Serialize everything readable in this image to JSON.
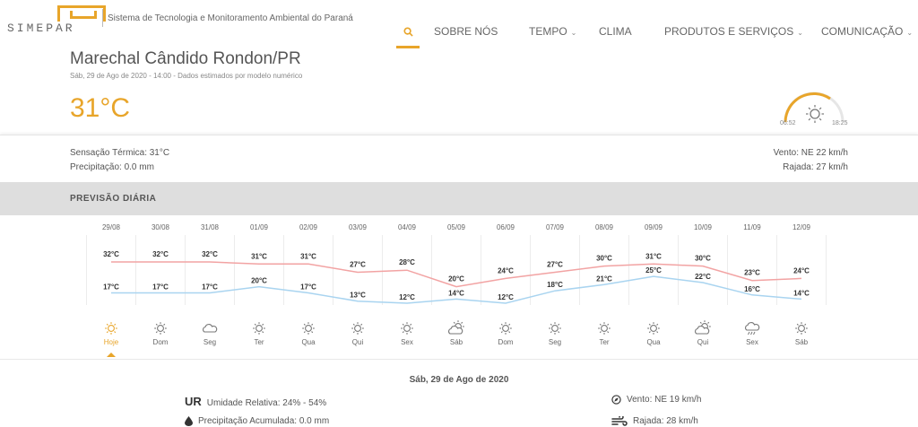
{
  "header": {
    "logo_text": "SIMEPAR",
    "org_name": "Sistema de Tecnologia e Monitoramento Ambiental do Paraná",
    "nav": [
      {
        "label": "SOBRE NÓS",
        "has_caret": false
      },
      {
        "label": "TEMPO",
        "has_caret": true
      },
      {
        "label": "CLIMA",
        "has_caret": false
      },
      {
        "label": "PRODUTOS E SERVIÇOS",
        "has_caret": true
      },
      {
        "label": "COMUNICAÇÃO",
        "has_caret": true
      }
    ],
    "search_icon": "search-icon"
  },
  "current": {
    "city": "Marechal Cândido Rondon/PR",
    "datetime": "Sáb, 29 de Ago de 2020 - 14:00 - Dados estimados por modelo numérico",
    "temperature": "31°C",
    "sunrise": "06:52",
    "sunset": "18:25"
  },
  "details": {
    "sensacao": "Sensação Térmica: 31°C",
    "precipitacao": "Precipitação: 0.0 mm",
    "vento": "Vento: NE 22 km/h",
    "rajada": "Rajada: 27 km/h"
  },
  "section": {
    "title": "PREVISÃO DIÁRIA"
  },
  "chart_data": {
    "type": "line",
    "x": [
      "29/08",
      "30/08",
      "31/08",
      "01/09",
      "02/09",
      "03/09",
      "04/09",
      "05/09",
      "06/09",
      "07/09",
      "08/09",
      "09/09",
      "10/09",
      "11/09",
      "12/09"
    ],
    "series": [
      {
        "values": [
          32,
          32,
          32,
          31,
          31,
          27,
          28,
          20,
          24,
          27,
          30,
          31,
          30,
          23,
          24
        ],
        "color": "#f2a3a3"
      },
      {
        "values": [
          17,
          17,
          17,
          20,
          17,
          13,
          12,
          14,
          12,
          18,
          21,
          25,
          22,
          16,
          14
        ],
        "color": "#a9d4f0"
      }
    ],
    "value_labels": {
      "max": [
        "32°C",
        "32°C",
        "32°C",
        "31°C",
        "31°C",
        "27°C",
        "28°C",
        "20°C",
        "24°C",
        "27°C",
        "30°C",
        "31°C",
        "30°C",
        "23°C",
        "24°C"
      ],
      "min": [
        "17°C",
        "17°C",
        "17°C",
        "20°C",
        "17°C",
        "13°C",
        "12°C",
        "14°C",
        "12°C",
        "18°C",
        "21°C",
        "25°C",
        "22°C",
        "16°C",
        "14°C"
      ]
    },
    "day_names": [
      "Hoje",
      "Dom",
      "Seg",
      "Ter",
      "Qua",
      "Qui",
      "Sex",
      "Sáb",
      "Dom",
      "Seg",
      "Ter",
      "Qua",
      "Qui",
      "Sex",
      "Sáb"
    ],
    "icons": [
      "sun-icon",
      "sun-icon",
      "cloud-icon",
      "sun-icon",
      "sun-icon",
      "sun-icon",
      "sun-icon",
      "sun-cloud-icon",
      "sun-icon",
      "sun-icon",
      "sun-icon",
      "sun-icon",
      "sun-cloud-icon",
      "rain-icon",
      "sun-icon"
    ],
    "accent": "#e8a52a"
  },
  "bottom": {
    "date": "Sáb, 29 de Ago de 2020",
    "ur_abbr": "UR",
    "umidade": "Umidade Relativa: 24% - 54%",
    "precipitacao": "Precipitação Acumulada: 0.0 mm",
    "vento": "Vento: NE 19 km/h",
    "rajada": "Rajada: 28 km/h"
  }
}
